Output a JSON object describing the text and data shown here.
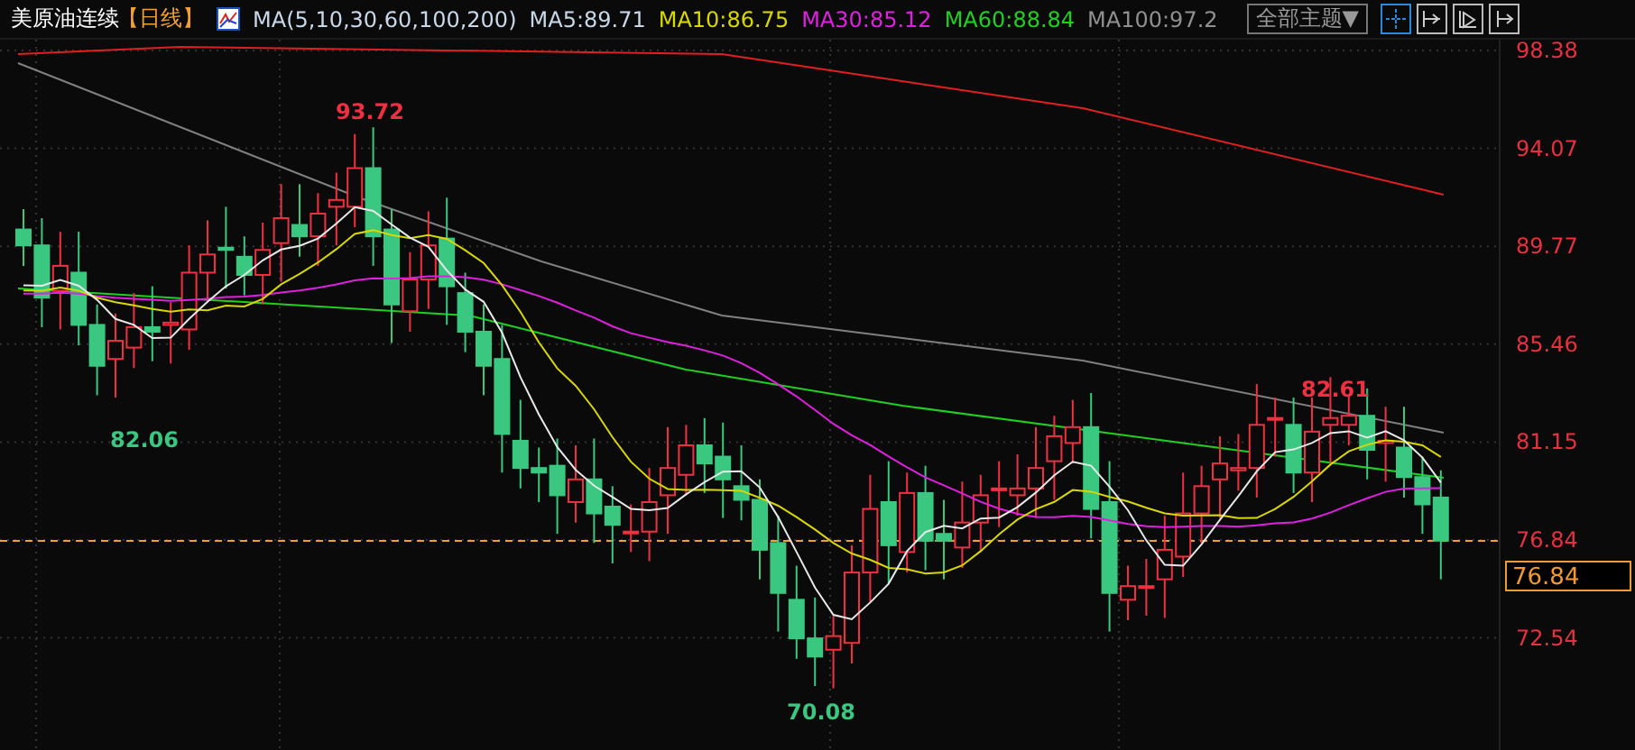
{
  "header": {
    "title": "美原油连续",
    "period": "【日线】",
    "indicator": "MA(5,10,30,60,100,200)",
    "ma_values": [
      {
        "label": "MA5:89.71",
        "color": "#c8d8e8"
      },
      {
        "label": "MA10:86.75",
        "color": "#d8d800"
      },
      {
        "label": "MA30:85.12",
        "color": "#e020e0"
      },
      {
        "label": "MA60:88.84",
        "color": "#20d020"
      },
      {
        "label": "MA100:97.2",
        "color": "#909090"
      }
    ],
    "theme_dropdown": "全部主题▼"
  },
  "chart": {
    "y_axis": [
      "98.38",
      "94.07",
      "89.77",
      "85.46",
      "81.15",
      "76.84",
      "72.54"
    ],
    "annotations": [
      {
        "text": "93.72",
        "kind": "high"
      },
      {
        "text": "82.06",
        "kind": "low"
      },
      {
        "text": "70.08",
        "kind": "low"
      },
      {
        "text": "82.61",
        "kind": "high"
      }
    ],
    "current_price": "76.84"
  }
}
